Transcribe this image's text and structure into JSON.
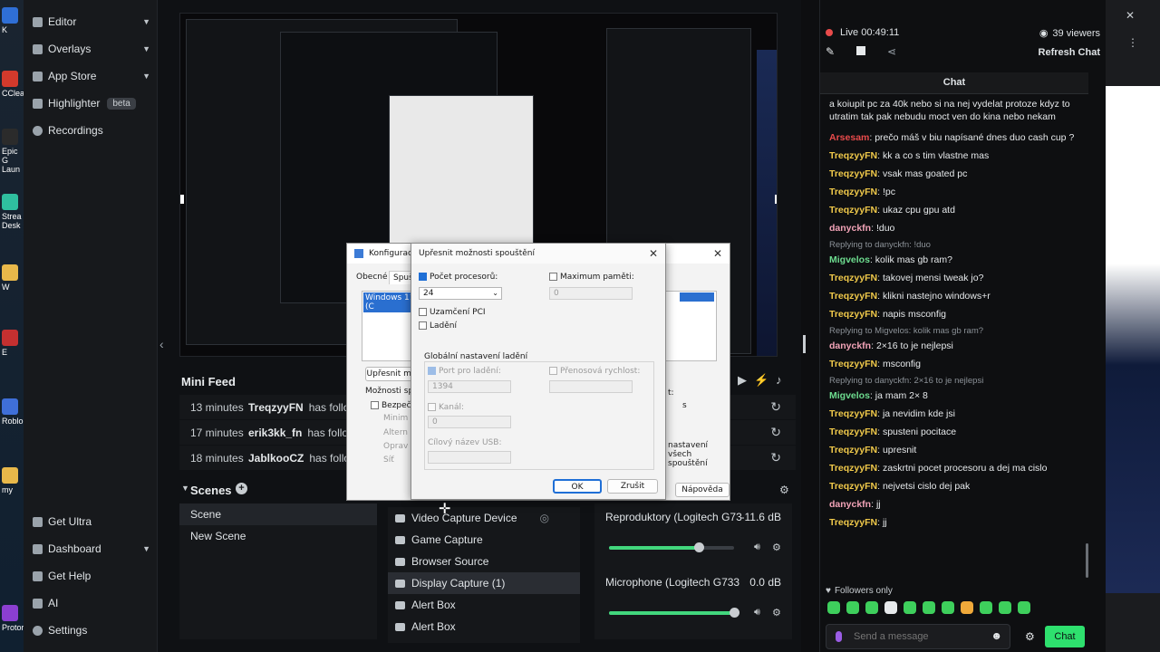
{
  "desktop": [
    {
      "label": "K",
      "color": "#2f6fd6"
    },
    {
      "label": "CClea",
      "color": "#d33a2c"
    },
    {
      "label": "Epic G\nLaun",
      "color": "#2b2b2b"
    },
    {
      "label": "Strea\nDesk",
      "color": "#2fbf9f"
    },
    {
      "label": "W",
      "color": "#e8b84a"
    },
    {
      "label": "E",
      "color": "#c43030"
    },
    {
      "label": "Roblo",
      "color": "#3f6fd8"
    },
    {
      "label": "my",
      "color": "#e8b84a"
    },
    {
      "label": "Protor",
      "color": "#8b3fd1"
    }
  ],
  "sidebar": {
    "top_items": [
      {
        "label": "Editor",
        "has_chevron": true
      },
      {
        "label": "Overlays",
        "has_chevron": true
      },
      {
        "label": "App Store",
        "has_chevron": true
      },
      {
        "label": "Highlighter",
        "badge": "beta"
      },
      {
        "label": "Recordings"
      }
    ],
    "bottom_items": [
      {
        "label": "Get Ultra"
      },
      {
        "label": "Dashboard",
        "has_chevron": true
      },
      {
        "label": "Get Help"
      },
      {
        "label": "AI"
      },
      {
        "label": "Settings"
      }
    ]
  },
  "mini_feed": {
    "title": "Mini Feed",
    "rows": [
      {
        "time": "13 minutes",
        "user": "TreqzyyFN",
        "action": "has followe"
      },
      {
        "time": "17 minutes",
        "user": "erik3kk_fn",
        "action": "has followe"
      },
      {
        "time": "18 minutes",
        "user": "JablkooCZ",
        "action": "has follow"
      }
    ]
  },
  "scenes": {
    "title": "Scenes",
    "items": [
      {
        "label": "Scene",
        "active": true
      },
      {
        "label": "New Scene",
        "active": false
      }
    ]
  },
  "sources": {
    "items": [
      {
        "label": "Video Capture Device",
        "active": false
      },
      {
        "label": "Game Capture",
        "active": false
      },
      {
        "label": "Browser Source",
        "active": false
      },
      {
        "label": "Display Capture (1)",
        "active": true
      },
      {
        "label": "Alert Box",
        "active": false
      },
      {
        "label": "Alert Box",
        "active": false
      }
    ]
  },
  "mixer": {
    "channels": [
      {
        "name": "Reproduktory (Logitech G733 ...",
        "db": "-11.6 dB",
        "level": 0.72
      },
      {
        "name": "Microphone (Logitech G733 G...",
        "db": "0.0 dB",
        "level": 1.0
      }
    ]
  },
  "dialog_back": {
    "title": "Konfigurace",
    "tabs": [
      "Obecné",
      "Spušt"
    ],
    "list_item": "Windows 11 (C",
    "advanced_button": "Upřesnit mo",
    "options_label": "Možnosti spuš",
    "safe_boot": "Bezpečné",
    "sub_options": [
      "Minim",
      "Altern",
      "Oprav",
      "Síť"
    ],
    "right_text_1": "t:",
    "right_text_2": "s",
    "right_text_3": "nastavení všech spouštění",
    "help_button": "Nápověda"
  },
  "dialog_front": {
    "title": "Upřesnit možnosti spouštění",
    "cpu_count_label": "Počet procesorů:",
    "cpu_count_value": "24",
    "max_memory_label": "Maximum paměti:",
    "max_memory_value": "0",
    "pci_lock": "Uzamčení PCI",
    "debug": "Ladění",
    "debug_section": "Globální nastavení ladění",
    "debug_port_label": "Port pro ladění:",
    "debug_port_value": "1394",
    "baud_rate_label": "Přenosová rychlost:",
    "channel_label": "Kanál:",
    "channel_value": "0",
    "usb_target_label": "Cílový název USB:",
    "ok_button": "OK",
    "cancel_button": "Zrušit"
  },
  "chat": {
    "live_label": "Live 00:49:11",
    "viewers": "39 viewers",
    "refresh_label": "Refresh Chat",
    "title": "Chat",
    "messages": [
      {
        "kind": "text",
        "text": "a koiupit pc za 40k nebo si na nej vydelat protoze kdyz to utratim tak pak nebudu moct ven do kina nebo nekam"
      },
      {
        "kind": "msg",
        "user": "Arsesam",
        "color": "red",
        "text": "prečo máš v biu napísané dnes duo cash cup ?"
      },
      {
        "kind": "msg",
        "user": "TreqzyyFN",
        "color": "gold",
        "text": "kk a co s tim vlastne mas"
      },
      {
        "kind": "msg",
        "user": "TreqzyyFN",
        "color": "gold",
        "text": "vsak mas goated pc"
      },
      {
        "kind": "msg",
        "user": "TreqzyyFN",
        "color": "gold",
        "text": "!pc"
      },
      {
        "kind": "msg",
        "user": "TreqzyyFN",
        "color": "gold",
        "text": "ukaz cpu gpu atd"
      },
      {
        "kind": "msg",
        "user": "danyckfn",
        "color": "pink",
        "text": "!duo"
      },
      {
        "kind": "reply",
        "text": "Replying to danyckfn: !duo"
      },
      {
        "kind": "msg",
        "user": "Migvelos",
        "color": "green",
        "text": "kolik mas gb ram?"
      },
      {
        "kind": "msg",
        "user": "TreqzyyFN",
        "color": "gold",
        "text": "takovej mensi tweak jo?"
      },
      {
        "kind": "msg",
        "user": "TreqzyyFN",
        "color": "gold",
        "text": "klikni nastejno windows+r"
      },
      {
        "kind": "msg",
        "user": "TreqzyyFN",
        "color": "gold",
        "text": "napis msconfig"
      },
      {
        "kind": "reply",
        "text": "Replying to Migvelos: kolik mas gb ram?"
      },
      {
        "kind": "msg",
        "user": "danyckfn",
        "color": "pink",
        "text": "2×16 to je nejlepsi"
      },
      {
        "kind": "msg",
        "user": "TreqzyyFN",
        "color": "gold",
        "text": "msconfig"
      },
      {
        "kind": "reply",
        "text": "Replying to danyckfn: 2×16 to je nejlepsi"
      },
      {
        "kind": "msg",
        "user": "Migvelos",
        "color": "green",
        "text": "ja mam 2× 8"
      },
      {
        "kind": "msg",
        "user": "TreqzyyFN",
        "color": "gold",
        "text": "ja nevidim kde jsi"
      },
      {
        "kind": "msg",
        "user": "TreqzyyFN",
        "color": "gold",
        "text": "spusteni pocitace"
      },
      {
        "kind": "msg",
        "user": "TreqzyyFN",
        "color": "gold",
        "text": "upresnit"
      },
      {
        "kind": "msg",
        "user": "TreqzyyFN",
        "color": "gold",
        "text": "zaskrtni pocet procesoru a dej ma cislo"
      },
      {
        "kind": "msg",
        "user": "TreqzyyFN",
        "color": "gold",
        "text": "nejvetsi cislo dej pak"
      },
      {
        "kind": "msg",
        "user": "danyckfn",
        "color": "pink",
        "text": "jj"
      },
      {
        "kind": "msg",
        "user": "TreqzyyFN",
        "color": "gold",
        "text": "jj"
      }
    ],
    "followers_only": "Followers only",
    "input_placeholder": "Send a message",
    "send_button": "Chat"
  },
  "colors": {
    "accent_green": "#42d77d",
    "live_red": "#e94b4b",
    "username_gold": "#f0c94a",
    "chat_button": "#2ee06e"
  }
}
